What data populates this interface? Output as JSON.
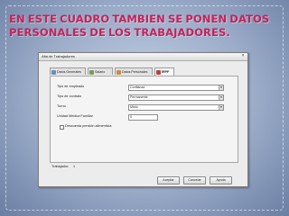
{
  "slide": {
    "heading_line1": "EN ESTE CUADRO TAMBIEN SE PONEN DATOS",
    "heading_line2": "PERSONALES DE LOS TRABAJADORES."
  },
  "window": {
    "title": "Alta de Trabajadores",
    "close_glyph": "×",
    "tabs": [
      {
        "label": "Datos Generales",
        "icon": "id-card-icon"
      },
      {
        "label": "Salario",
        "icon": "money-icon"
      },
      {
        "label": "Datos Personales",
        "icon": "person-icon"
      },
      {
        "label": "IRPF",
        "icon": "tax-icon",
        "active": true
      }
    ],
    "fields": {
      "tipo_empleado": {
        "label": "Tipo de empleado",
        "value": "Confianza"
      },
      "tipo_contrato": {
        "label": "Tipo de contrato",
        "value": "Permanente"
      },
      "turno": {
        "label": "Turno",
        "value": "Mixto"
      },
      "unidad_familiar": {
        "label": "Unidad Médica Familiar",
        "value": "0"
      },
      "pension": {
        "label": "Descuenta pensión alimenticia",
        "checked": false
      }
    },
    "footer": {
      "trabajador_label": "Trabajador:",
      "trabajador_value": "1",
      "accept_label": "Aceptar",
      "cancel_label": "Cancelar",
      "help_label": "Ayuda"
    }
  },
  "colors": {
    "heading": "#c4225a",
    "slide_bg": "#9aabc8"
  }
}
